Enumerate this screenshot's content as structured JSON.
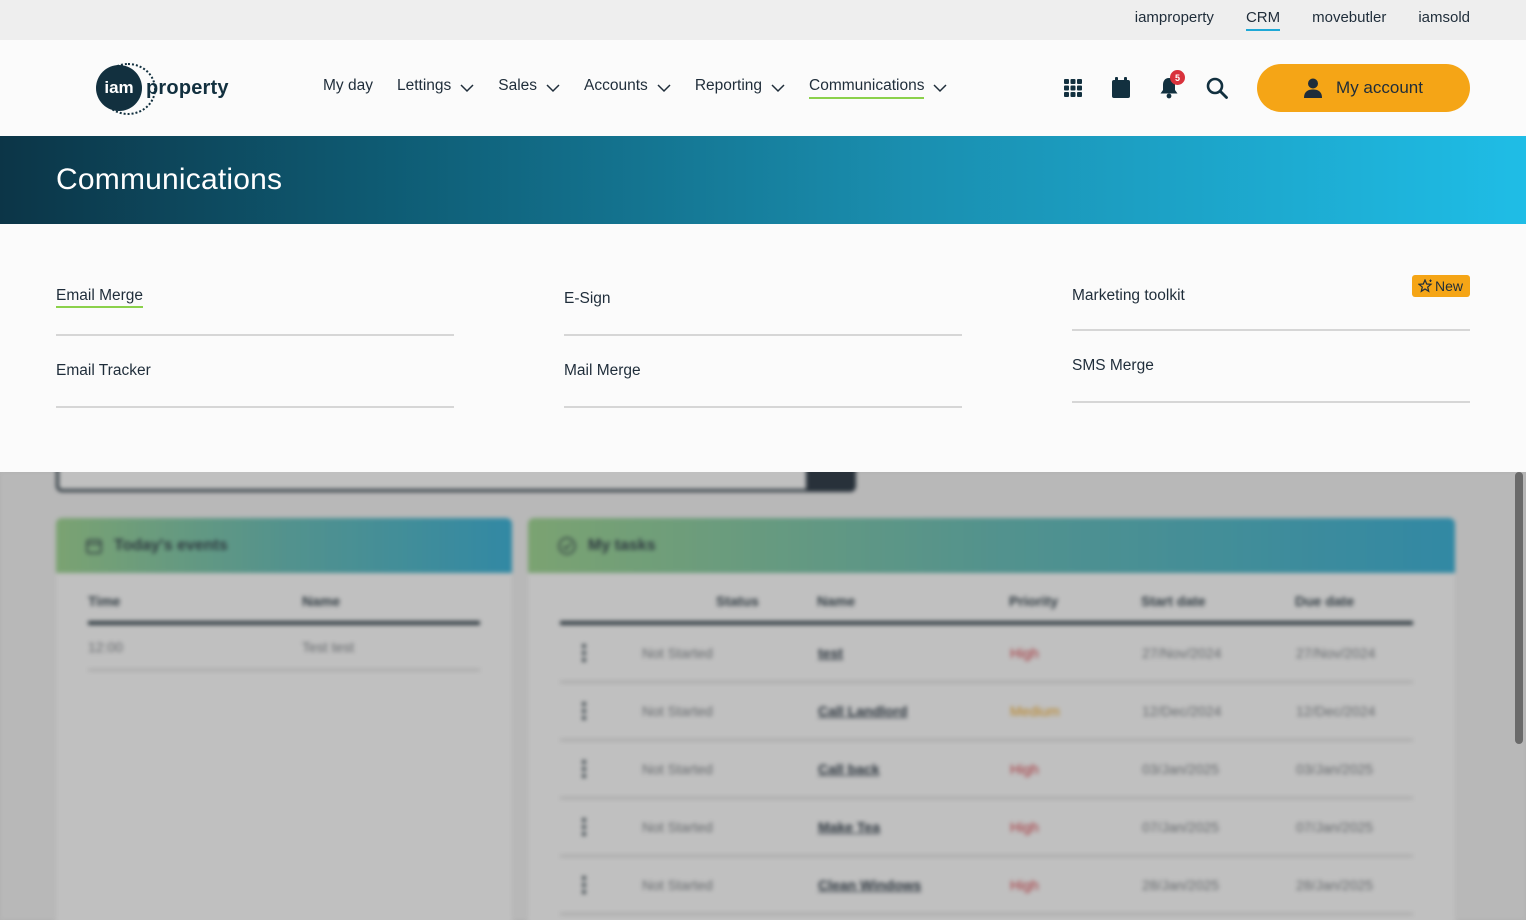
{
  "utility_links": [
    {
      "label": "iamproperty",
      "active": false
    },
    {
      "label": "CRM",
      "active": true
    },
    {
      "label": "movebutler",
      "active": false
    },
    {
      "label": "iamsold",
      "active": false
    }
  ],
  "logo": {
    "mark": "iam",
    "word": "property"
  },
  "nav": [
    {
      "label": "My day",
      "has_dropdown": false
    },
    {
      "label": "Lettings",
      "has_dropdown": true
    },
    {
      "label": "Sales",
      "has_dropdown": true
    },
    {
      "label": "Accounts",
      "has_dropdown": true
    },
    {
      "label": "Reporting",
      "has_dropdown": true
    },
    {
      "label": "Communications",
      "has_dropdown": true,
      "active": true
    }
  ],
  "header_icons": {
    "apps": "grid-icon",
    "calendar": "calendar-icon",
    "notifications": "bell-icon",
    "notification_count": "5",
    "search": "search-icon"
  },
  "account_button": {
    "label": "My account",
    "color": "#f5a516"
  },
  "banner": {
    "title": "Communications"
  },
  "menu": {
    "columns": [
      [
        {
          "label": "Email Merge",
          "active": true
        },
        {
          "label": "Email Tracker"
        }
      ],
      [
        {
          "label": "E-Sign"
        },
        {
          "label": "Mail Merge"
        }
      ],
      [
        {
          "label": "Marketing toolkit",
          "badge": "New"
        },
        {
          "label": "SMS Merge"
        }
      ]
    ]
  },
  "background": {
    "events_card": {
      "title": "Today's events",
      "columns": [
        "Time",
        "Name"
      ],
      "rows": [
        [
          "12:00",
          "Test test"
        ]
      ]
    },
    "tasks_card": {
      "title": "My tasks",
      "columns": [
        "Status",
        "Name",
        "Priority",
        "Start date",
        "Due date"
      ],
      "rows": [
        {
          "status": "Not Started",
          "name": "test",
          "priority": "High",
          "start": "27/Nov/2024",
          "due": "27/Nov/2024"
        },
        {
          "status": "Not Started",
          "name": "Call Landlord",
          "priority": "Medium",
          "start": "12/Dec/2024",
          "due": "12/Dec/2024"
        },
        {
          "status": "Not Started",
          "name": "Call back",
          "priority": "High",
          "start": "03/Jan/2025",
          "due": "03/Jan/2025"
        },
        {
          "status": "Not Started",
          "name": "Make Tea",
          "priority": "High",
          "start": "07/Jan/2025",
          "due": "07/Jan/2025"
        },
        {
          "status": "Not Started",
          "name": "Clean Windows",
          "priority": "High",
          "start": "28/Jan/2025",
          "due": "28/Jan/2025"
        }
      ]
    }
  },
  "colors": {
    "accent": "#f5a516",
    "active_underline": "#8bd14b",
    "banner_dark": "#0c3547",
    "banner_light": "#1fbde6"
  }
}
